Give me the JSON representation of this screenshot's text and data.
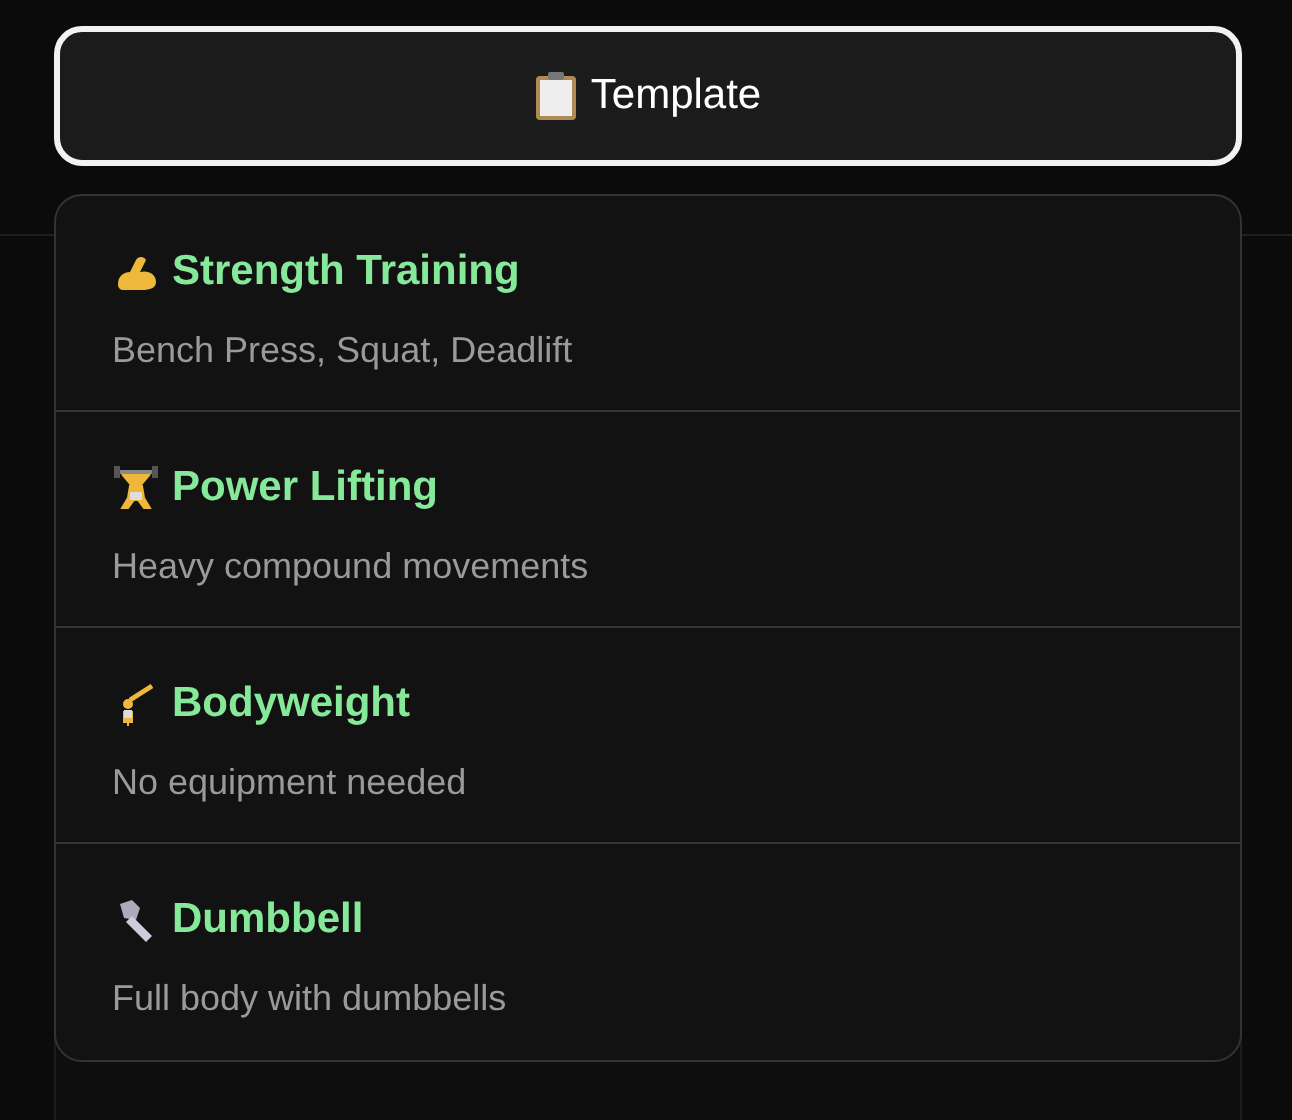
{
  "template_button": {
    "label": "Template",
    "expanded": true
  },
  "templates": [
    {
      "title": "Strength Training",
      "description": "Bench Press, Squat, Deadlift"
    },
    {
      "title": "Power Lifting",
      "description": "Heavy compound movements"
    },
    {
      "title": "Bodyweight",
      "description": "No equipment needed"
    },
    {
      "title": "Dumbbell",
      "description": "Full body with dumbbells"
    }
  ]
}
